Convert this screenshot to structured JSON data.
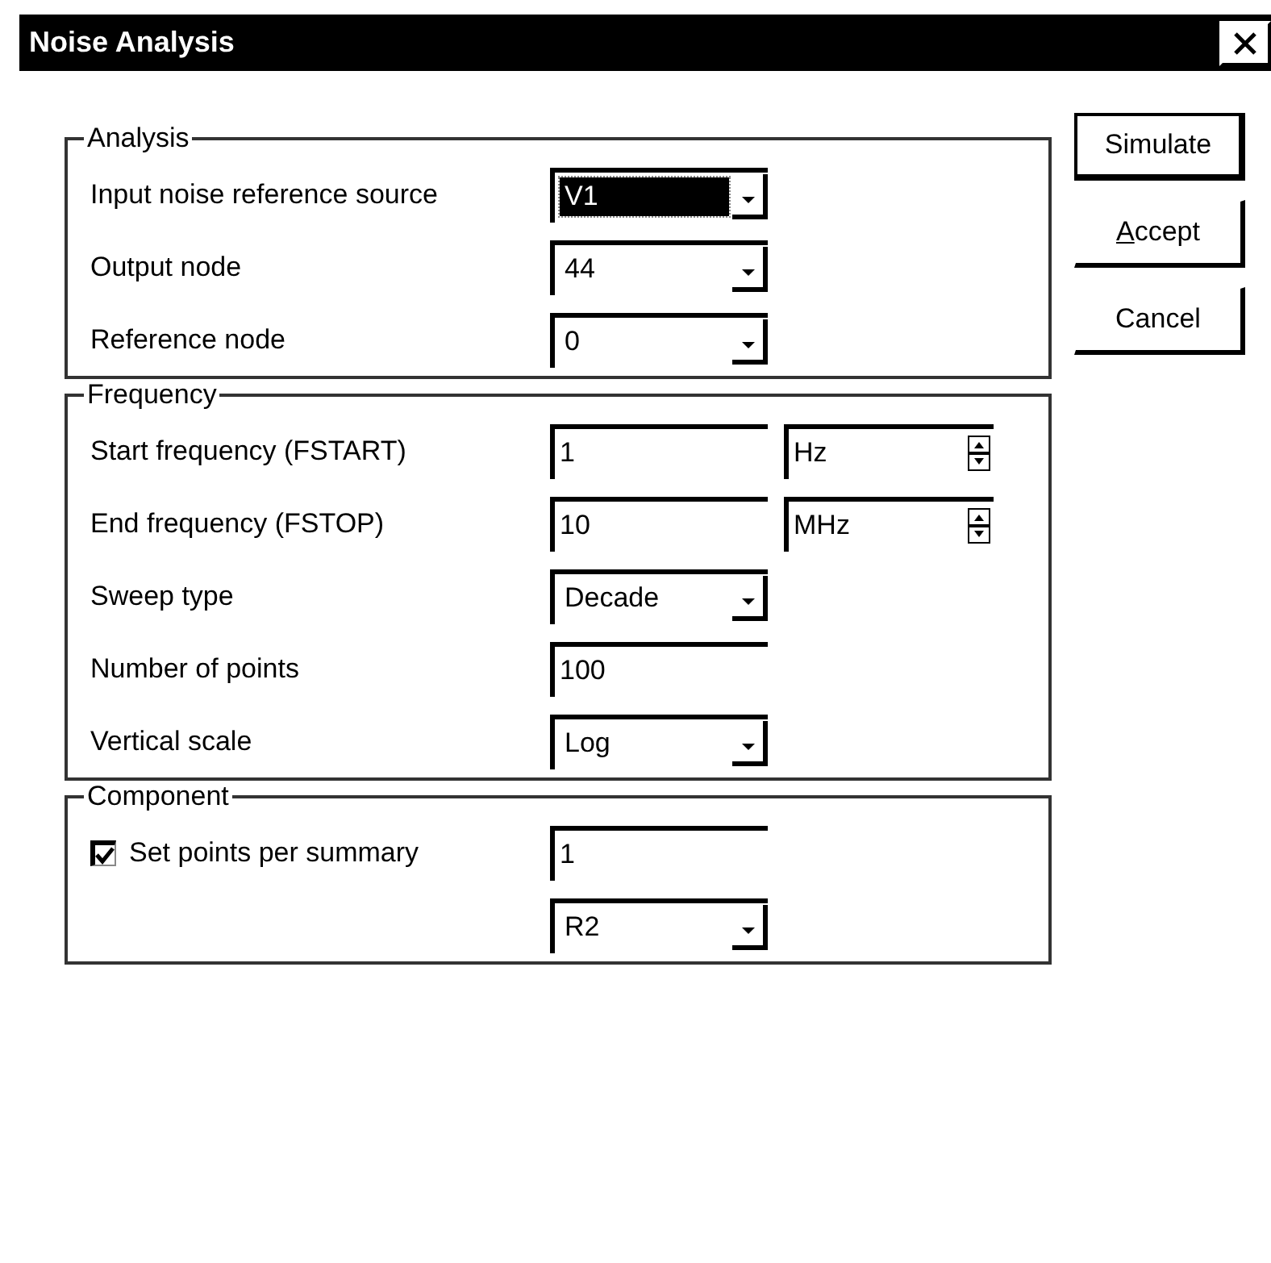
{
  "window": {
    "title": "Noise Analysis"
  },
  "groups": [
    {
      "title": "Analysis",
      "rows": [
        {
          "kind": "text",
          "label": "Input noise reference source",
          "controls": [
            {
              "kind": "combo",
              "value": "V1",
              "highlighted": true
            }
          ]
        },
        {
          "kind": "text",
          "label": "Output node",
          "controls": [
            {
              "kind": "combo",
              "value": "44",
              "highlighted": false
            }
          ]
        },
        {
          "kind": "text",
          "label": "Reference node",
          "controls": [
            {
              "kind": "combo",
              "value": "0",
              "highlighted": false
            }
          ]
        }
      ]
    },
    {
      "title": "Frequency",
      "rows": [
        {
          "kind": "text",
          "label": "Start frequency (FSTART)",
          "controls": [
            {
              "kind": "field",
              "value": "1"
            },
            {
              "kind": "spin",
              "value": "Hz"
            }
          ]
        },
        {
          "kind": "text",
          "label": "End frequency (FSTOP)",
          "controls": [
            {
              "kind": "field",
              "value": "10"
            },
            {
              "kind": "spin",
              "value": "MHz"
            }
          ]
        },
        {
          "kind": "text",
          "label": "Sweep type",
          "controls": [
            {
              "kind": "combo",
              "value": "Decade",
              "highlighted": false
            }
          ]
        },
        {
          "kind": "text",
          "label": "Number of points",
          "controls": [
            {
              "kind": "field",
              "value": "100"
            }
          ]
        },
        {
          "kind": "text",
          "label": "Vertical scale",
          "controls": [
            {
              "kind": "combo",
              "value": "Log",
              "highlighted": false
            }
          ]
        }
      ]
    },
    {
      "title": "Component",
      "rows": [
        {
          "kind": "check",
          "label": "Set points per summary",
          "checked": true,
          "controls": [
            {
              "kind": "field",
              "value": "1"
            }
          ]
        },
        {
          "kind": "blank",
          "controls": [
            {
              "kind": "combo",
              "value": "R2",
              "highlighted": false
            }
          ]
        }
      ]
    }
  ],
  "buttons": [
    {
      "label": "Simulate",
      "default": true,
      "underline_first": false
    },
    {
      "label": "Accept",
      "default": false,
      "underline_first": true
    },
    {
      "label": "Cancel",
      "default": false,
      "underline_first": false
    }
  ]
}
